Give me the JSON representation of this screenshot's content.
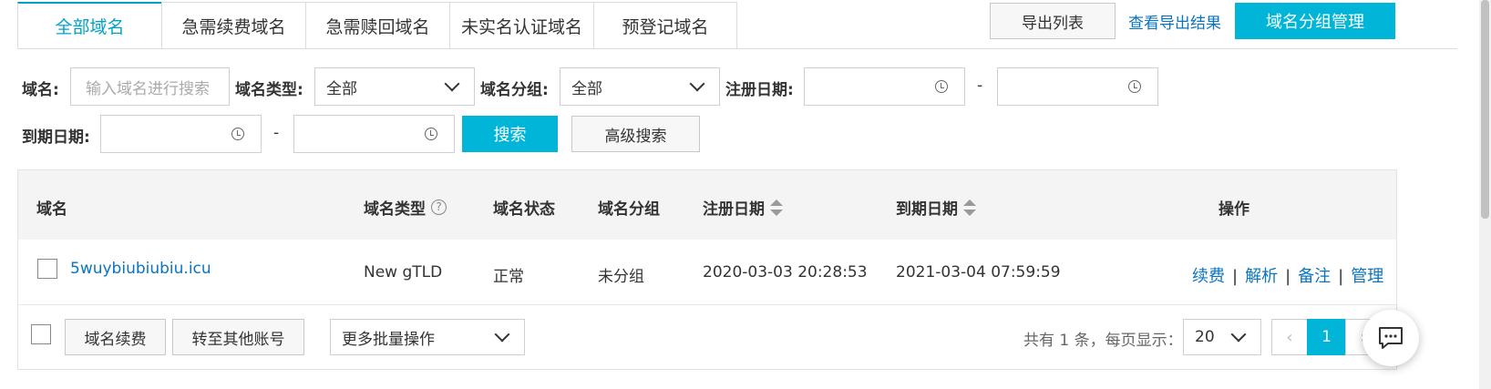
{
  "tabs": [
    {
      "label": "全部域名",
      "active": true
    },
    {
      "label": "急需续费域名",
      "active": false
    },
    {
      "label": "急需赎回域名",
      "active": false
    },
    {
      "label": "未实名认证域名",
      "active": false
    },
    {
      "label": "预登记域名",
      "active": false
    }
  ],
  "top_actions": {
    "export_list": "导出列表",
    "view_export": "查看导出结果",
    "group_manage": "域名分组管理"
  },
  "filters": {
    "domain_label": "域名:",
    "domain_placeholder": "输入域名进行搜索",
    "type_label": "域名类型:",
    "type_value": "全部",
    "group_label": "域名分组:",
    "group_value": "全部",
    "reg_date_label": "注册日期:",
    "exp_date_label": "到期日期:",
    "range_sep": "-",
    "search_button": "搜索",
    "advanced_button": "高级搜索"
  },
  "table": {
    "headers": {
      "domain": "域名",
      "type": "域名类型",
      "status": "域名状态",
      "group": "域名分组",
      "reg_date": "注册日期",
      "exp_date": "到期日期",
      "actions": "操作"
    },
    "rows": [
      {
        "domain": "5wuybiubiubiu.icu",
        "type": "New gTLD",
        "status": "正常",
        "group": "未分组",
        "reg_date": "2020-03-03 20:28:53",
        "exp_date": "2021-03-04 07:59:59",
        "actions": [
          "续费",
          "解析",
          "备注",
          "管理"
        ],
        "sep": "|"
      }
    ]
  },
  "footer": {
    "renew_button": "域名续费",
    "transfer_button": "转至其他账号",
    "batch_select": "更多批量操作",
    "total_text": "共有 1 条，每页显示：",
    "page_size": "20",
    "current_page": "1",
    "prev": "‹",
    "next": "›"
  },
  "colors": {
    "accent": "#00b5d8",
    "link": "#0a73c2"
  },
  "icons": {
    "help": "?"
  }
}
